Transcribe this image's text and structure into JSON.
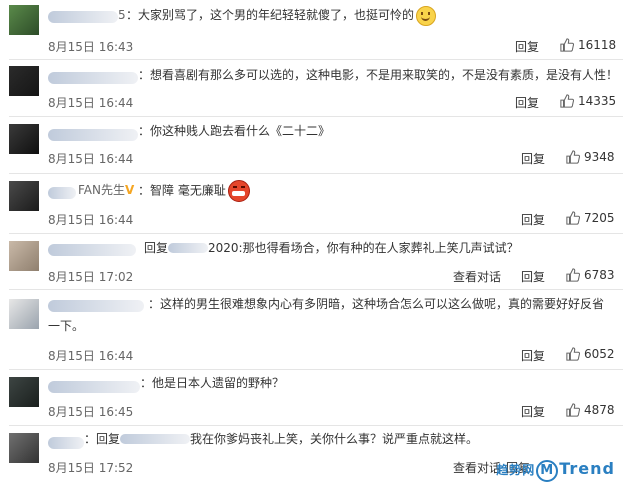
{
  "comments": [
    {
      "name_visible": "5",
      "text": "：大家别骂了，这个男的年纪轻轻就傻了，也挺可怜的",
      "emoji": "smile-emoji",
      "time": "8月15日 16:43",
      "action": "回复",
      "likes": "16118"
    },
    {
      "name_visible": "",
      "text": "：想看喜剧有那么多可以选的，这种电影，不是用来取笑的，不是没有素质，是没有人性！",
      "emoji": "",
      "time": "8月15日 16:44",
      "action": "回复",
      "likes": "14335"
    },
    {
      "name_visible": "",
      "text": "：你这种贱人跑去看什么《二十二》",
      "emoji": "",
      "time": "8月15日 16:44",
      "action": "回复",
      "likes": "9348"
    },
    {
      "name_visible": "FAN先生",
      "text": "：智障 毫无廉耻",
      "emoji": "angry-emoji",
      "time": "8月15日 16:44",
      "action": "回复",
      "likes": "7205"
    },
    {
      "name_visible": "",
      "text": "回复",
      "text2": "2020:那也得看场合，你有种的在人家葬礼上笑几声试试？",
      "emoji": "",
      "time": "8月15日 17:02",
      "view": "查看对话",
      "action": "回复",
      "likes": "6783"
    },
    {
      "name_visible": "",
      "text": "：这样的男生很难想象内心有多阴暗，这种场合怎么可以这么做呢，真的需要好好反省",
      "text_line2": "一下。",
      "emoji": "",
      "time": "8月15日 16:44",
      "action": "回复",
      "likes": "6052"
    },
    {
      "name_visible": "",
      "text": "：他是日本人遗留的野种？",
      "emoji": "",
      "time": "8月15日 16:45",
      "action": "回复",
      "likes": "4878"
    },
    {
      "name_visible": "",
      "text": "：回复",
      "text2": "我在你爹妈丧礼上笑，关你什么事？说严重点就这样。",
      "emoji": "",
      "time": "8月15日 17:52",
      "view": "查看对话",
      "action": "回复",
      "likes": ""
    }
  ],
  "watermark": {
    "left": "趋势网",
    "m": "M",
    "right": "Trend"
  }
}
